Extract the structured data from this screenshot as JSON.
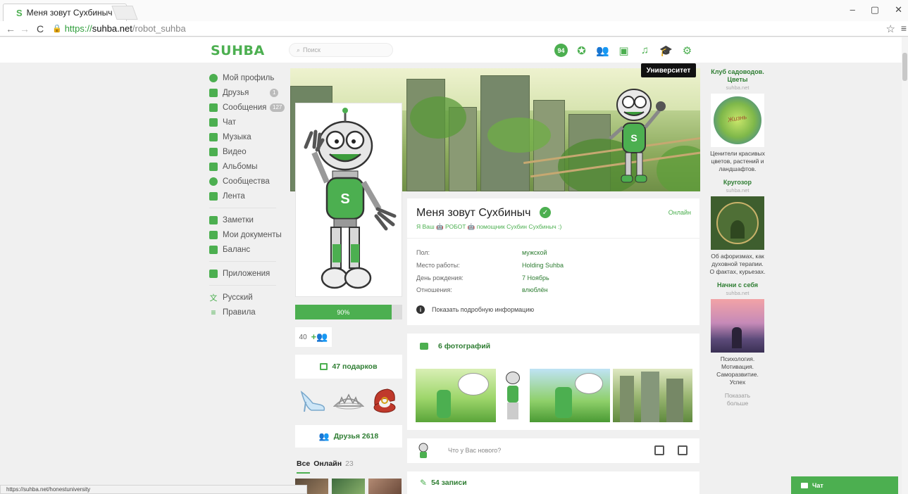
{
  "browser": {
    "tab_title": "Меня зовут Сухбиныч",
    "tab_favicon": "S",
    "tab_close": "×",
    "url_protocol": "https://",
    "url_host": "suhba.net",
    "url_path": "/robot_suhba",
    "win_min": "–",
    "win_max": "▢",
    "win_close": "✕",
    "status_url": "https://suhba.net/honestuniversity"
  },
  "header": {
    "logo": "SUHBA",
    "search_placeholder": "Поиск",
    "notif_count": "94",
    "tooltip": "Университет",
    "icons": [
      "notifications-icon",
      "community-icon",
      "friends-icon",
      "video-icon",
      "music-icon",
      "university-icon",
      "settings-icon"
    ]
  },
  "nav": {
    "items": [
      {
        "label": "Мой профиль"
      },
      {
        "label": "Друзья",
        "count": "1"
      },
      {
        "label": "Сообщения",
        "count": "127"
      },
      {
        "label": "Чат"
      },
      {
        "label": "Музыка"
      },
      {
        "label": "Видео"
      },
      {
        "label": "Альбомы"
      },
      {
        "label": "Сообщества"
      },
      {
        "label": "Лента"
      }
    ],
    "items2": [
      {
        "label": "Заметки"
      },
      {
        "label": "Мои документы"
      },
      {
        "label": "Баланс"
      }
    ],
    "apps": "Приложения",
    "language": "Русский",
    "rules": "Правила"
  },
  "profile": {
    "name": "Меня зовут Сухбиныч",
    "online": "Онлайн",
    "status": "Я Ваш 🤖 РОБОТ 🤖 помощник Сухбин Сухбиныч :)",
    "fields": [
      {
        "label": "Пол:",
        "value": "мужской"
      },
      {
        "label": "Место работы:",
        "value": "Holding Suhba"
      },
      {
        "label": "День рождения:",
        "value": "7 Ноябрь"
      },
      {
        "label": "Отношения:",
        "value": "влюблён"
      }
    ],
    "more_info": "Показать подробную информацию",
    "progress": 0.9,
    "progress_label": "90%",
    "followers": "40",
    "gifts_label": "47 подарков",
    "friends_label": "Друзья 2618",
    "friends_tab_all": "Все",
    "friends_tab_online": "Онлайн",
    "friends_online_count": "23"
  },
  "photos": {
    "title": "6 фотографий"
  },
  "composer": {
    "placeholder": "Что у Вас нового?"
  },
  "posts": {
    "title": "54 записи"
  },
  "ads": [
    {
      "title": "Клуб садоводов. Цветы",
      "site": "suhba.net",
      "desc": "Ценители красивых цветов, растений и ландшафтов."
    },
    {
      "title": "Кругозор",
      "site": "suhba.net",
      "desc": "Об афоризмах, как духовной терапии. О фактах, курьезах."
    },
    {
      "title": "Начни с себя",
      "site": "suhba.net",
      "desc": "Психология. Мотивация. Саморазвитие. Успех"
    }
  ],
  "ads_more": "Показать больше",
  "chat": {
    "label": "Чат"
  },
  "colors": {
    "accent": "#4caf50",
    "accent_dark": "#2e7d32"
  }
}
